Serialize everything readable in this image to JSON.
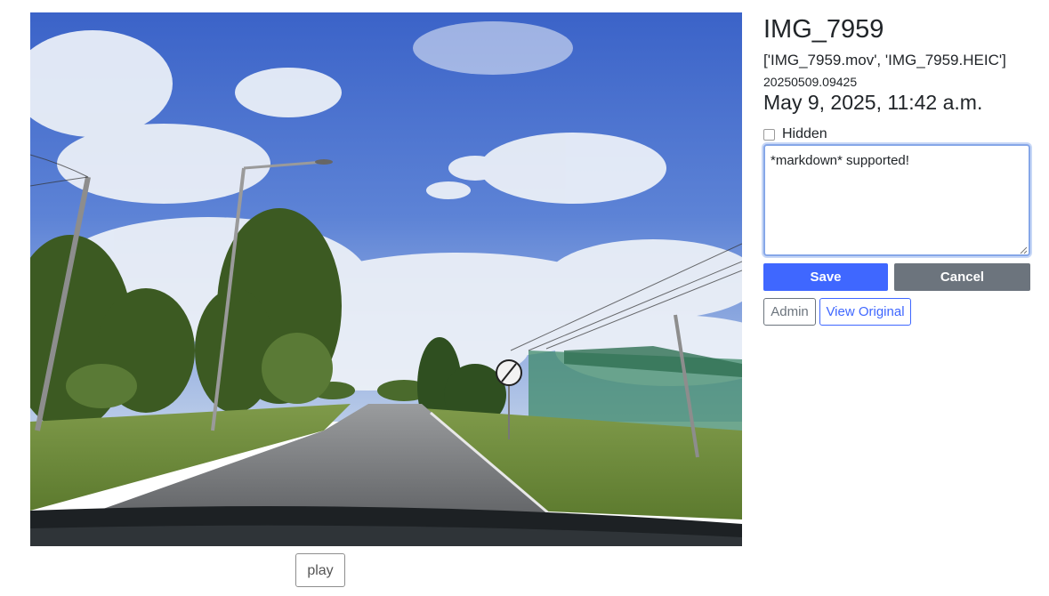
{
  "photo": {
    "description_icon": "photo-road-sky"
  },
  "media": {
    "play_label": "play"
  },
  "details": {
    "title": "IMG_7959",
    "files": "['IMG_7959.mov', 'IMG_7959.HEIC']",
    "code": "20250509.09425",
    "date": "May 9, 2025, 11:42 a.m.",
    "hidden_label": "Hidden",
    "hidden_checked": false,
    "notes_value": "*markdown* supported!"
  },
  "actions": {
    "save_label": "Save",
    "cancel_label": "Cancel",
    "admin_label": "Admin",
    "view_original_label": "View Original"
  },
  "colors": {
    "primary": "#3f67ff",
    "secondary": "#6c747d",
    "focus": "#86a7e8"
  }
}
